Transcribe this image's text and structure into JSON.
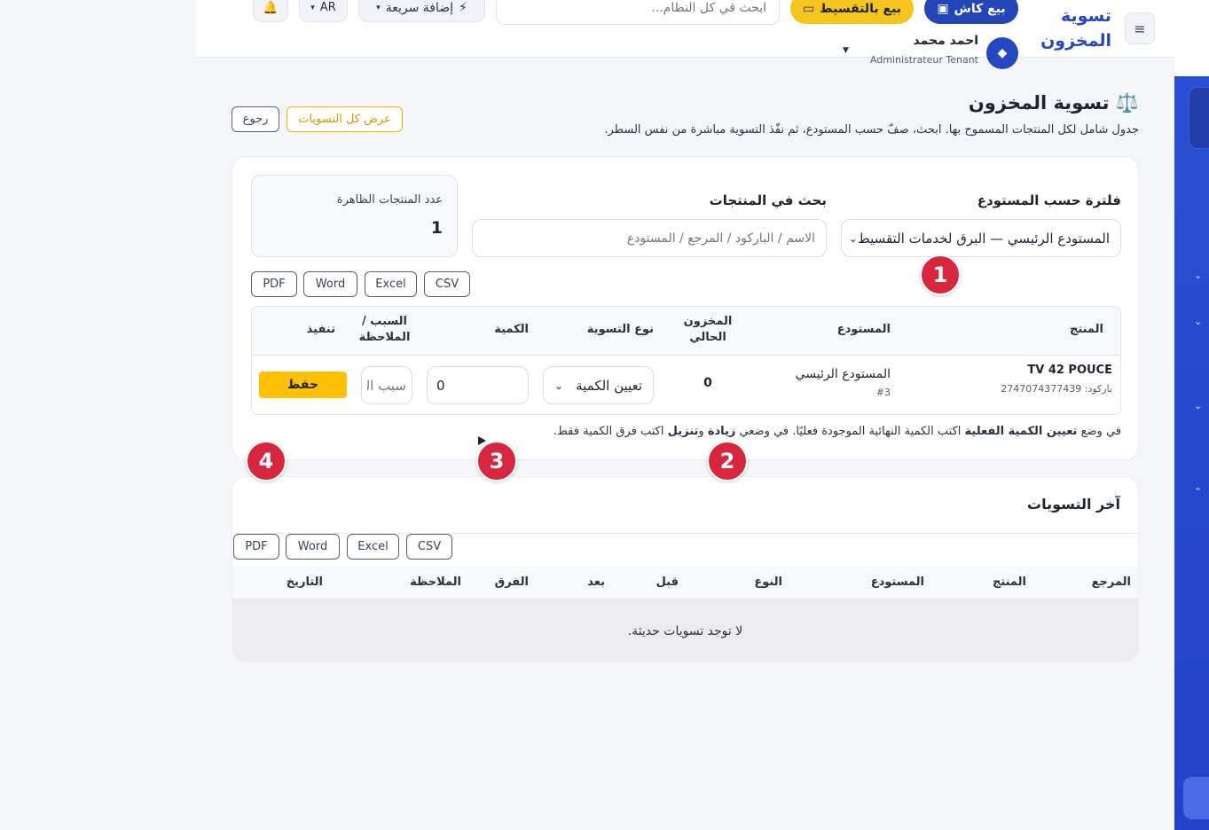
{
  "header": {
    "brand": "تسوية المخزون",
    "cash_sale": "بيع كاش",
    "installment_sale": "بيع بالتقسيط",
    "search_placeholder": "ابحث في كل النظام...",
    "quick_add": "إضافة سريعة",
    "lang": "AR",
    "user_name": "احمد محمد",
    "user_role": "Administrateur Tenant"
  },
  "page": {
    "title": "تسوية المخزون",
    "subtitle": "جدول شامل لكل المنتجات المسموح بها. ابحث، صفّ حسب المستودع، ثم نفّذ التسوية مباشرة من نفس السطر.",
    "show_all": "عرض كل التسويات",
    "back": "رجوع"
  },
  "filters": {
    "warehouse_label": "فلترة حسب المستودع",
    "warehouse_value": "المستودع الرئيسي — البرق لخدمات التقسيط",
    "search_label": "بحث في المنتجات",
    "search_placeholder": "الاسم / الباركود / المرجع / المستودع",
    "count_label": "عدد المنتجات الظاهرة",
    "count_value": "1"
  },
  "exports": {
    "csv": "CSV",
    "excel": "Excel",
    "word": "Word",
    "pdf": "PDF"
  },
  "table": {
    "headers": {
      "product": "المنتج",
      "warehouse": "المستودع",
      "current_stock": "المخزون الحالي",
      "adj_type": "نوع التسوية",
      "quantity": "الكمية",
      "reason": "السبب / الملاحظة",
      "execute": "تنفيذ"
    },
    "row": {
      "product_name": "TV 42 POUCE",
      "barcode": "باركود: 2747074377439",
      "warehouse": "المستودع الرئيسي",
      "warehouse_id": "#3",
      "stock": "0",
      "adj_type": "تعيين الكمية",
      "quantity": "0",
      "reason_placeholder": "سبب التسوية",
      "save": "حفظ"
    }
  },
  "hint": {
    "part1": "في وضع ",
    "bold1": "تعيين الكمية الفعلية",
    "part2": " اكتب الكمية النهائية الموجودة فعليًا. في وضعي ",
    "bold2": "زيادة",
    "part3": " و",
    "bold3": "تنزيل",
    "part4": " اكتب فرق الكمية فقط."
  },
  "recent": {
    "title": "آخر التسويات",
    "headers": [
      "المرجع",
      "المنتج",
      "المستودع",
      "النوع",
      "قبل",
      "بعد",
      "الفرق",
      "الملاحظة",
      "التاريخ"
    ],
    "empty": "لا توجد تسويات حديثة."
  },
  "steps": [
    "1",
    "2",
    "3",
    "4"
  ],
  "colors": {
    "primary": "#2345b5",
    "accent": "#ffc107",
    "badge": "#d7263d"
  }
}
